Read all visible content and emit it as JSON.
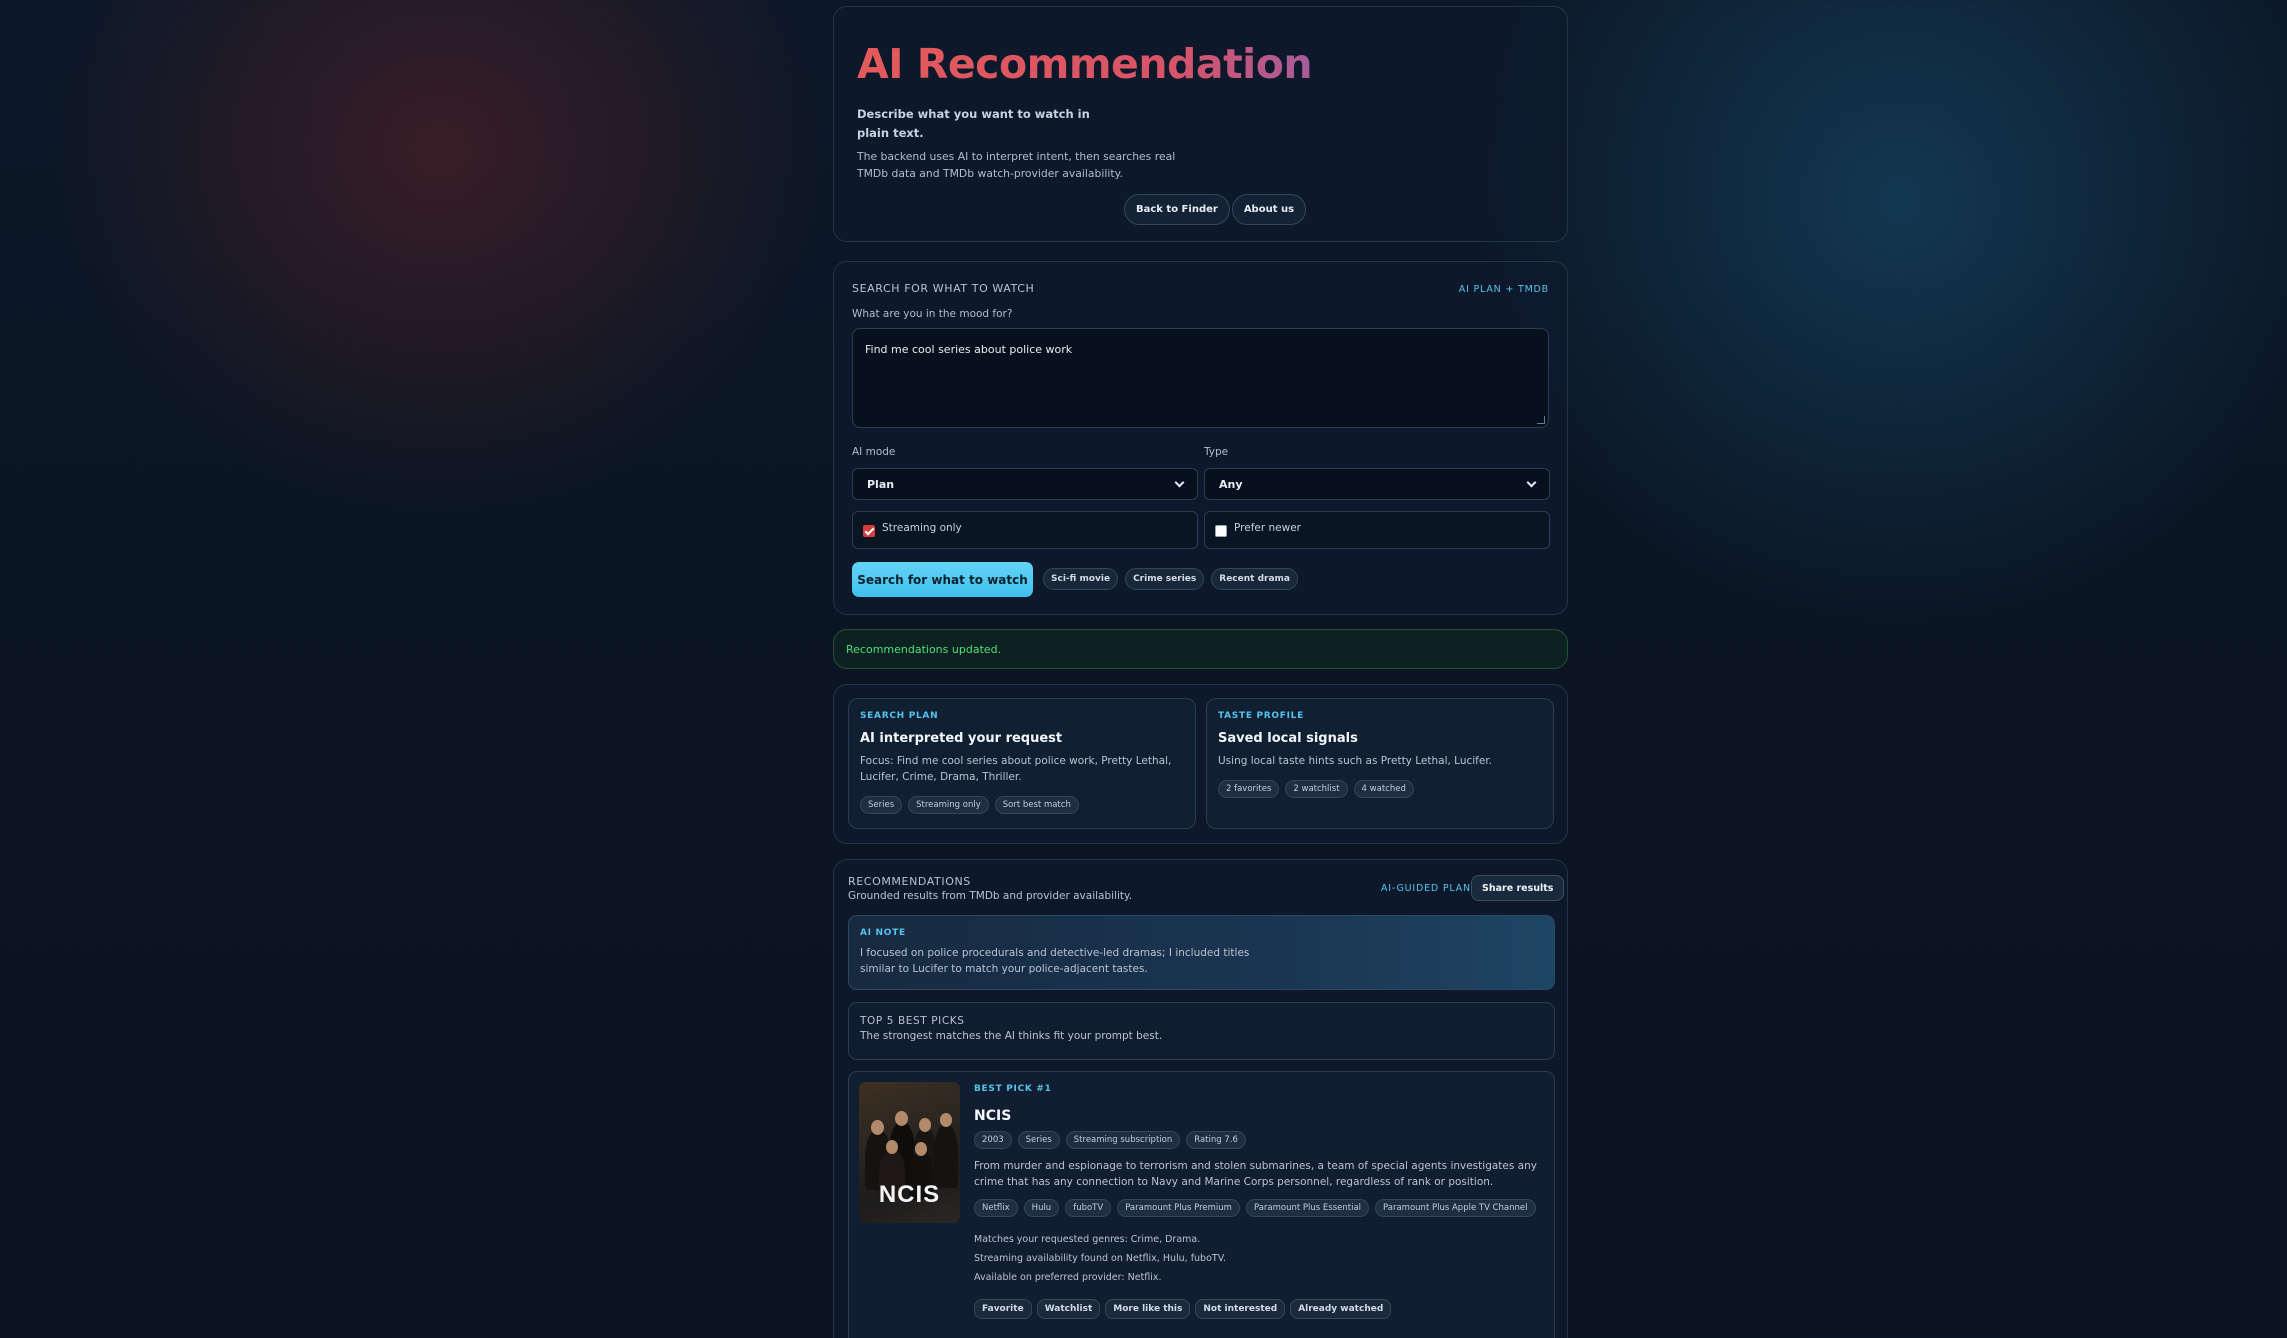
{
  "hero": {
    "title": "AI Recommendation",
    "lead": "Describe what you want to watch in plain text.",
    "sub": "The backend uses AI to interpret intent, then searches real TMDb data and TMDb watch-provider availability.",
    "back_label": "Back to Finder",
    "about_label": "About us"
  },
  "search": {
    "section_title": "SEARCH FOR WHAT TO WATCH",
    "badge": "AI PLAN + TMDB",
    "prompt_label": "What are you in the mood for?",
    "prompt_value": "Find me cool series about police work",
    "mode_label": "AI mode",
    "mode_value": "Plan",
    "type_label": "Type",
    "type_value": "Any",
    "streaming_only_label": "Streaming only",
    "streaming_only_checked": true,
    "prefer_newer_label": "Prefer newer",
    "prefer_newer_checked": false,
    "submit_label": "Search for what to watch",
    "presets": [
      "Sci-fi movie",
      "Crime series",
      "Recent drama"
    ]
  },
  "status": {
    "message": "Recommendations updated."
  },
  "plan": {
    "eyebrow": "SEARCH PLAN",
    "title": "AI interpreted your request",
    "focus": "Focus: Find me cool series about police work, Pretty Lethal, Lucifer, Crime, Drama, Thriller.",
    "tags": [
      "Series",
      "Streaming only",
      "Sort best match"
    ]
  },
  "taste": {
    "eyebrow": "TASTE PROFILE",
    "title": "Saved local signals",
    "text": "Using local taste hints such as Pretty Lethal, Lucifer.",
    "tags": [
      "2 favorites",
      "2 watchlist",
      "4 watched"
    ]
  },
  "recommendations": {
    "section_title": "RECOMMENDATIONS",
    "subtitle": "Grounded results from TMDb and provider availability.",
    "badge": "AI-GUIDED PLAN",
    "share_label": "Share results",
    "note_eyebrow": "AI NOTE",
    "note_text": "I focused on police procedurals and detective-led dramas; I included titles similar to Lucifer to match your police-adjacent tastes.",
    "top_title": "TOP 5 BEST PICKS",
    "top_sub": "The strongest matches the AI thinks fit your prompt best."
  },
  "pick": {
    "eyebrow": "BEST PICK #1",
    "title": "NCIS",
    "poster_text": "NCIS",
    "meta": [
      "2003",
      "Series",
      "Streaming subscription",
      "Rating 7.6"
    ],
    "overview": "From murder and espionage to terrorism and stolen submarines, a team of special agents investigates any crime that has any connection to Navy and Marine Corps personnel, regardless of rank or position.",
    "providers": [
      "Netflix",
      "Hulu",
      "fuboTV",
      "Paramount Plus Premium",
      "Paramount Plus Essential",
      "Paramount Plus Apple TV Channel"
    ],
    "reasons": [
      "Matches your requested genres: Crime, Drama.",
      "Streaming availability found on Netflix, Hulu, fuboTV.",
      "Available on preferred provider: Netflix."
    ],
    "actions": [
      "Favorite",
      "Watchlist",
      "More like this",
      "Not interested",
      "Already watched"
    ]
  }
}
